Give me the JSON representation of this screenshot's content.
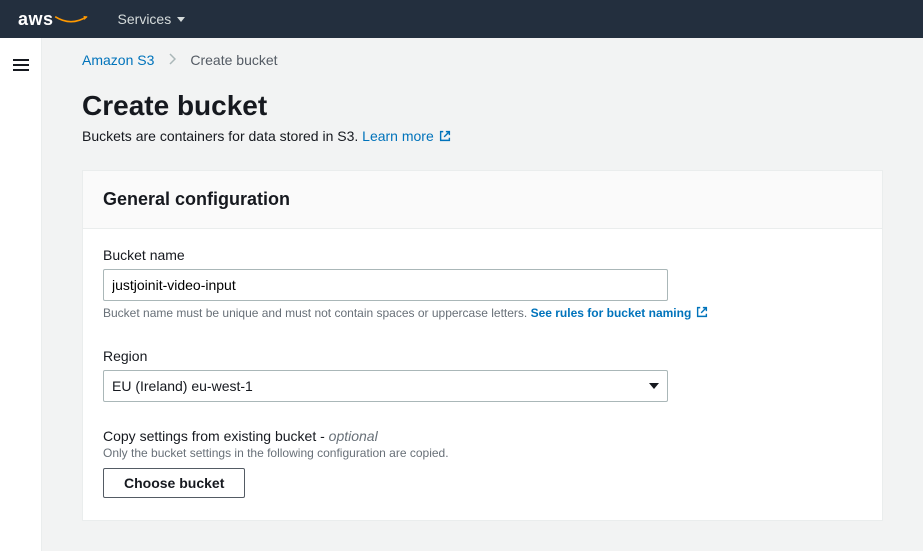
{
  "topnav": {
    "logo_text": "aws",
    "services_label": "Services"
  },
  "breadcrumb": {
    "root": "Amazon S3",
    "current": "Create bucket"
  },
  "page": {
    "title": "Create bucket",
    "description_prefix": "Buckets are containers for data stored in S3. ",
    "learn_more": "Learn more"
  },
  "panel": {
    "header": "General configuration",
    "bucket_name": {
      "label": "Bucket name",
      "value": "justjoinit-video-input",
      "hint_prefix": "Bucket name must be unique and must not contain spaces or uppercase letters. ",
      "hint_link": "See rules for bucket naming"
    },
    "region": {
      "label": "Region",
      "value": "EU (Ireland) eu-west-1"
    },
    "copy_settings": {
      "title_prefix": "Copy settings from existing bucket - ",
      "optional": "optional",
      "hint": "Only the bucket settings in the following configuration are copied.",
      "button": "Choose bucket"
    }
  }
}
